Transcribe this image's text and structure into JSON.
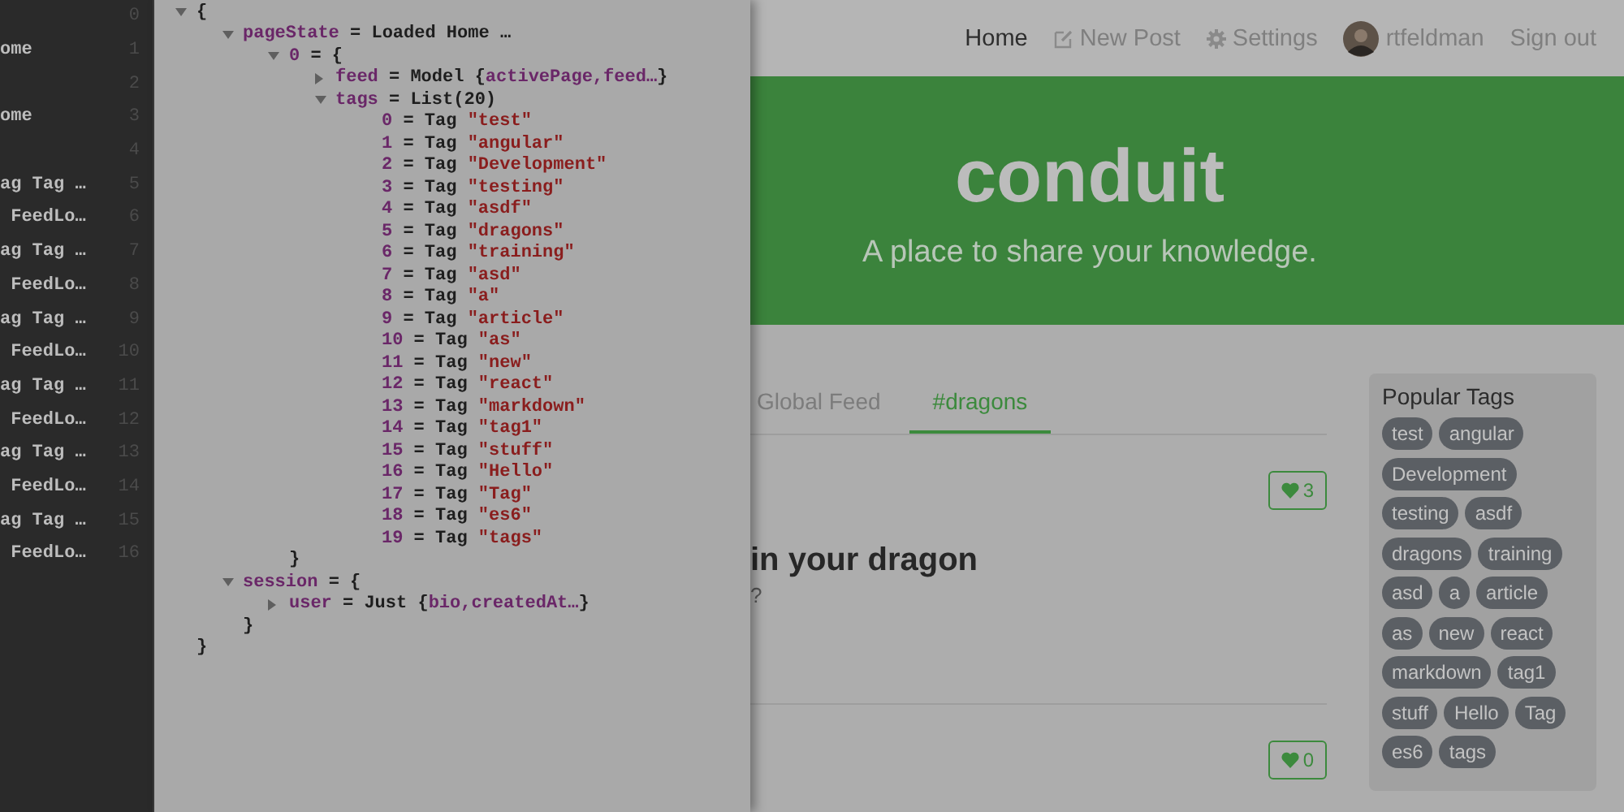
{
  "history": [
    {
      "number": "0"
    },
    {
      "text": "ome",
      "number": "1"
    },
    {
      "number": "2"
    },
    {
      "text": "ome",
      "number": "3"
    },
    {
      "number": "4"
    },
    {
      "text": "ag Tag …",
      "number": "5"
    },
    {
      "text": " FeedLo…",
      "number": "6"
    },
    {
      "text": "ag Tag …",
      "number": "7"
    },
    {
      "text": " FeedLo…",
      "number": "8"
    },
    {
      "text": "ag Tag …",
      "number": "9"
    },
    {
      "text": " FeedLo…",
      "number": "10"
    },
    {
      "text": "ag Tag …",
      "number": "11"
    },
    {
      "text": " FeedLo…",
      "number": "12"
    },
    {
      "text": "ag Tag …",
      "number": "13"
    },
    {
      "text": " FeedLo…",
      "number": "14"
    },
    {
      "text": "ag Tag …",
      "number": "15"
    },
    {
      "text": " FeedLo…",
      "number": "16"
    }
  ],
  "tree": {
    "expanded": true,
    "parts": [
      {
        "kind": "plain",
        "text": "{"
      }
    ],
    "close": "}",
    "children": [
      {
        "expanded": true,
        "parts": [
          {
            "kind": "key",
            "text": "pageState"
          },
          {
            "kind": "plain",
            "text": " = Loaded Home …"
          }
        ],
        "children": [
          {
            "expanded": true,
            "parts": [
              {
                "kind": "key",
                "text": "0"
              },
              {
                "kind": "plain",
                "text": " = {"
              }
            ],
            "close": "}",
            "children": [
              {
                "expanded": false,
                "parts": [
                  {
                    "kind": "key",
                    "text": "feed"
                  },
                  {
                    "kind": "plain",
                    "text": " = Model {"
                  },
                  {
                    "kind": "key",
                    "text": "activePage,feed…"
                  },
                  {
                    "kind": "plain",
                    "text": "}"
                  }
                ]
              },
              {
                "expanded": true,
                "parts": [
                  {
                    "kind": "key",
                    "text": "tags"
                  },
                  {
                    "kind": "plain",
                    "text": " = List(20)"
                  }
                ],
                "children": [
                  {
                    "parts": [
                      {
                        "kind": "key",
                        "text": "0"
                      },
                      {
                        "kind": "plain",
                        "text": " = Tag "
                      },
                      {
                        "kind": "string",
                        "text": "\"test\""
                      }
                    ]
                  },
                  {
                    "parts": [
                      {
                        "kind": "key",
                        "text": "1"
                      },
                      {
                        "kind": "plain",
                        "text": " = Tag "
                      },
                      {
                        "kind": "string",
                        "text": "\"angular\""
                      }
                    ]
                  },
                  {
                    "parts": [
                      {
                        "kind": "key",
                        "text": "2"
                      },
                      {
                        "kind": "plain",
                        "text": " = Tag "
                      },
                      {
                        "kind": "string",
                        "text": "\"Development\""
                      }
                    ]
                  },
                  {
                    "parts": [
                      {
                        "kind": "key",
                        "text": "3"
                      },
                      {
                        "kind": "plain",
                        "text": " = Tag "
                      },
                      {
                        "kind": "string",
                        "text": "\"testing\""
                      }
                    ]
                  },
                  {
                    "parts": [
                      {
                        "kind": "key",
                        "text": "4"
                      },
                      {
                        "kind": "plain",
                        "text": " = Tag "
                      },
                      {
                        "kind": "string",
                        "text": "\"asdf\""
                      }
                    ]
                  },
                  {
                    "parts": [
                      {
                        "kind": "key",
                        "text": "5"
                      },
                      {
                        "kind": "plain",
                        "text": " = Tag "
                      },
                      {
                        "kind": "string",
                        "text": "\"dragons\""
                      }
                    ]
                  },
                  {
                    "parts": [
                      {
                        "kind": "key",
                        "text": "6"
                      },
                      {
                        "kind": "plain",
                        "text": " = Tag "
                      },
                      {
                        "kind": "string",
                        "text": "\"training\""
                      }
                    ]
                  },
                  {
                    "parts": [
                      {
                        "kind": "key",
                        "text": "7"
                      },
                      {
                        "kind": "plain",
                        "text": " = Tag "
                      },
                      {
                        "kind": "string",
                        "text": "\"asd\""
                      }
                    ]
                  },
                  {
                    "parts": [
                      {
                        "kind": "key",
                        "text": "8"
                      },
                      {
                        "kind": "plain",
                        "text": " = Tag "
                      },
                      {
                        "kind": "string",
                        "text": "\"a\""
                      }
                    ]
                  },
                  {
                    "parts": [
                      {
                        "kind": "key",
                        "text": "9"
                      },
                      {
                        "kind": "plain",
                        "text": " = Tag "
                      },
                      {
                        "kind": "string",
                        "text": "\"article\""
                      }
                    ]
                  },
                  {
                    "parts": [
                      {
                        "kind": "key",
                        "text": "10"
                      },
                      {
                        "kind": "plain",
                        "text": " = Tag "
                      },
                      {
                        "kind": "string",
                        "text": "\"as\""
                      }
                    ]
                  },
                  {
                    "parts": [
                      {
                        "kind": "key",
                        "text": "11"
                      },
                      {
                        "kind": "plain",
                        "text": " = Tag "
                      },
                      {
                        "kind": "string",
                        "text": "\"new\""
                      }
                    ]
                  },
                  {
                    "parts": [
                      {
                        "kind": "key",
                        "text": "12"
                      },
                      {
                        "kind": "plain",
                        "text": " = Tag "
                      },
                      {
                        "kind": "string",
                        "text": "\"react\""
                      }
                    ]
                  },
                  {
                    "parts": [
                      {
                        "kind": "key",
                        "text": "13"
                      },
                      {
                        "kind": "plain",
                        "text": " = Tag "
                      },
                      {
                        "kind": "string",
                        "text": "\"markdown\""
                      }
                    ]
                  },
                  {
                    "parts": [
                      {
                        "kind": "key",
                        "text": "14"
                      },
                      {
                        "kind": "plain",
                        "text": " = Tag "
                      },
                      {
                        "kind": "string",
                        "text": "\"tag1\""
                      }
                    ]
                  },
                  {
                    "parts": [
                      {
                        "kind": "key",
                        "text": "15"
                      },
                      {
                        "kind": "plain",
                        "text": " = Tag "
                      },
                      {
                        "kind": "string",
                        "text": "\"stuff\""
                      }
                    ]
                  },
                  {
                    "parts": [
                      {
                        "kind": "key",
                        "text": "16"
                      },
                      {
                        "kind": "plain",
                        "text": " = Tag "
                      },
                      {
                        "kind": "string",
                        "text": "\"Hello\""
                      }
                    ]
                  },
                  {
                    "parts": [
                      {
                        "kind": "key",
                        "text": "17"
                      },
                      {
                        "kind": "plain",
                        "text": " = Tag "
                      },
                      {
                        "kind": "string",
                        "text": "\"Tag\""
                      }
                    ]
                  },
                  {
                    "parts": [
                      {
                        "kind": "key",
                        "text": "18"
                      },
                      {
                        "kind": "plain",
                        "text": " = Tag "
                      },
                      {
                        "kind": "string",
                        "text": "\"es6\""
                      }
                    ]
                  },
                  {
                    "parts": [
                      {
                        "kind": "key",
                        "text": "19"
                      },
                      {
                        "kind": "plain",
                        "text": " = Tag "
                      },
                      {
                        "kind": "string",
                        "text": "\"tags\""
                      }
                    ]
                  }
                ]
              }
            ]
          }
        ]
      },
      {
        "expanded": true,
        "parts": [
          {
            "kind": "key",
            "text": "session"
          },
          {
            "kind": "plain",
            "text": " = {"
          }
        ],
        "close": "}",
        "children": [
          {
            "expanded": false,
            "parts": [
              {
                "kind": "key",
                "text": "user"
              },
              {
                "kind": "plain",
                "text": " = Just {"
              },
              {
                "kind": "key",
                "text": "bio,createdAt…"
              },
              {
                "kind": "plain",
                "text": "}"
              }
            ]
          }
        ]
      }
    ]
  },
  "nav": [
    {
      "label": "Home",
      "selected": true,
      "kind": "plain"
    },
    {
      "label": "New Post",
      "selected": false,
      "kind": "compose"
    },
    {
      "label": "Settings",
      "selected": false,
      "kind": "settings"
    },
    {
      "label": "rtfeldman",
      "selected": false,
      "kind": "profile"
    },
    {
      "label": "Sign out",
      "selected": false,
      "kind": "plain"
    }
  ],
  "banner": {
    "logo": "conduit",
    "tagline": "A place to share your knowledge."
  },
  "feed_tabs": [
    {
      "label": "Global Feed",
      "selected": false
    },
    {
      "label": "#dragons",
      "selected": true
    }
  ],
  "articles": [
    {
      "likes": "3",
      "title": "in your dragon",
      "description": "?"
    },
    {
      "likes": "0"
    }
  ],
  "popular_tags": {
    "title": "Popular Tags",
    "tags": [
      "test",
      "angular",
      "Development",
      "testing",
      "asdf",
      "dragons",
      "training",
      "asd",
      "a",
      "article",
      "as",
      "new",
      "react",
      "markdown",
      "tag1",
      "stuff",
      "Hello",
      "Tag",
      "es6",
      "tags"
    ]
  }
}
